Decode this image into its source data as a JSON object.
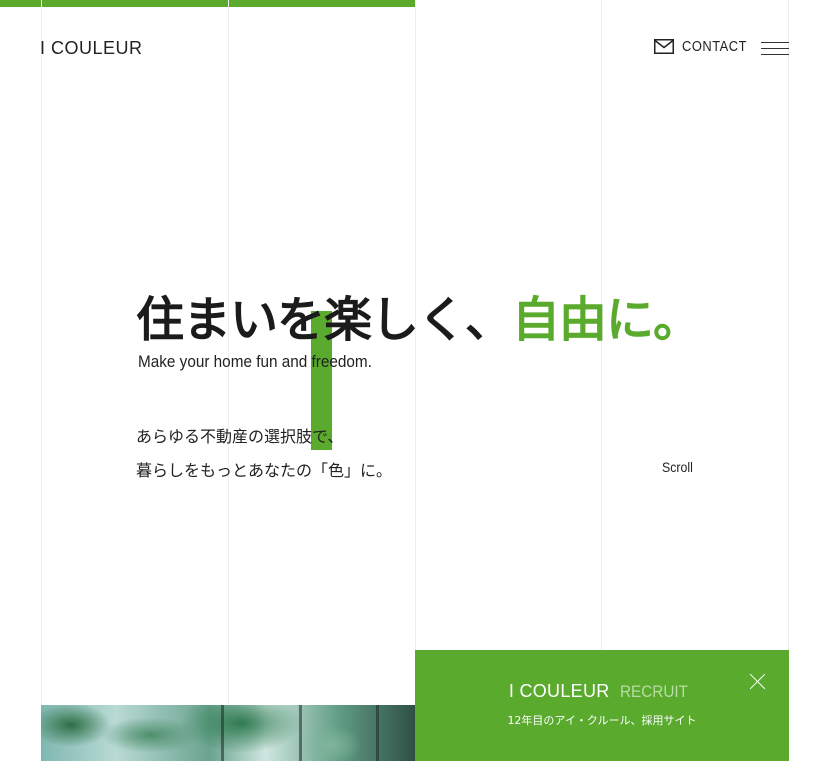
{
  "header": {
    "logo": "I COULEUR",
    "contact_label": "CONTACT",
    "contact_icon": "mail-icon",
    "menu_icon": "hamburger-menu-icon"
  },
  "hero": {
    "headline_main": "住まいを楽しく、",
    "headline_accent": "自由に。",
    "tagline": "Make your home fun and freedom.",
    "copy_line1": "あらゆる不動産の選択肢で、",
    "copy_line2": "暮らしをもっとあなたの「色」に。",
    "scroll_label": "Scroll"
  },
  "recruit_banner": {
    "brand": "I COULEUR",
    "label": "RECRUIT",
    "description": "12年目のアイ・クルール、採用サイト",
    "close_icon": "close-icon"
  },
  "colors": {
    "accent": "#5aaa2e",
    "text": "#222222",
    "background": "#ffffff"
  }
}
